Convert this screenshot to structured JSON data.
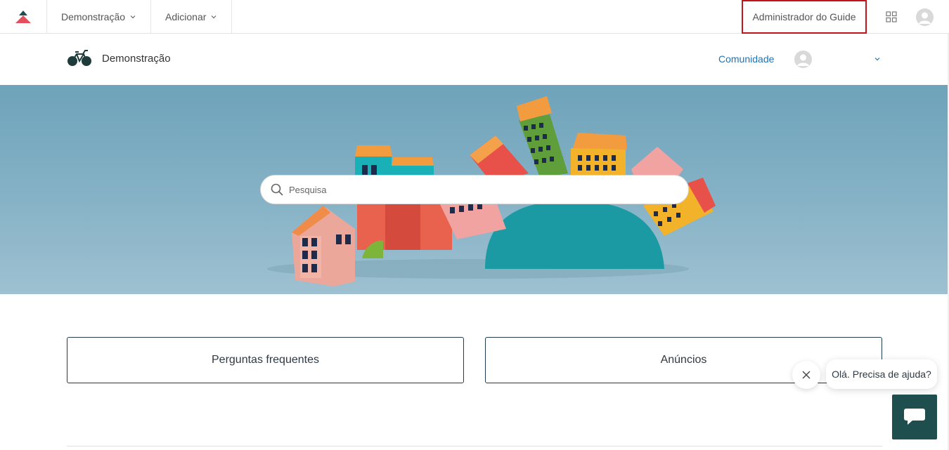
{
  "admin_bar": {
    "menus": [
      {
        "label": "Demonstração"
      },
      {
        "label": "Adicionar"
      }
    ],
    "guide_admin_label": "Administrador do Guide",
    "icons": {
      "logo": "zendesk-logo-icon",
      "apps": "grid-icon",
      "avatar": "user-avatar-icon"
    },
    "accent": "#c2141c"
  },
  "header": {
    "brand_name": "Demonstração",
    "community_label": "Comunidade",
    "link_color": "#1f73b7"
  },
  "search": {
    "placeholder": "Pesquisa"
  },
  "blocks": [
    {
      "label": "Perguntas frequentes"
    },
    {
      "label": "Anúncios"
    }
  ],
  "chat": {
    "greeting": "Olá. Precisa de ajuda?",
    "launcher_color": "#1f4e4f"
  }
}
